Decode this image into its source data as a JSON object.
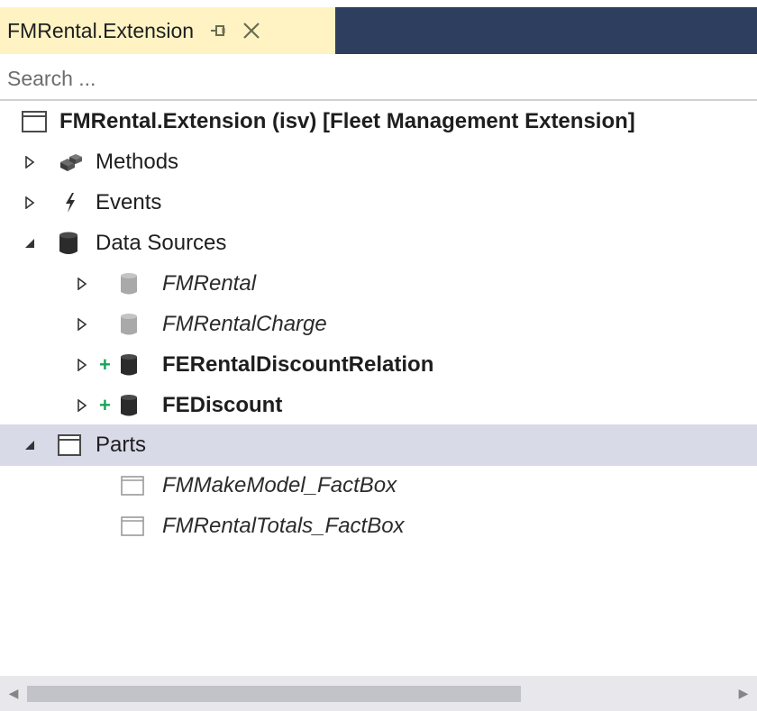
{
  "tab": {
    "title": "FMRental.Extension"
  },
  "search": {
    "placeholder": "Search ..."
  },
  "tree": {
    "root": "FMRental.Extension (isv) [Fleet Management Extension]",
    "methods": "Methods",
    "events": "Events",
    "data_sources": {
      "label": "Data Sources",
      "items": [
        "FMRental",
        "FMRentalCharge",
        "FERentalDiscountRelation",
        "FEDiscount"
      ]
    },
    "parts": {
      "label": "Parts",
      "items": [
        "FMMakeModel_FactBox",
        "FMRentalTotals_FactBox"
      ]
    }
  },
  "colors": {
    "title_bar": "#2d3e5f",
    "active_tab": "#fff3c4",
    "selected_row": "#d9dae8",
    "added_marker": "#1aa35a"
  }
}
